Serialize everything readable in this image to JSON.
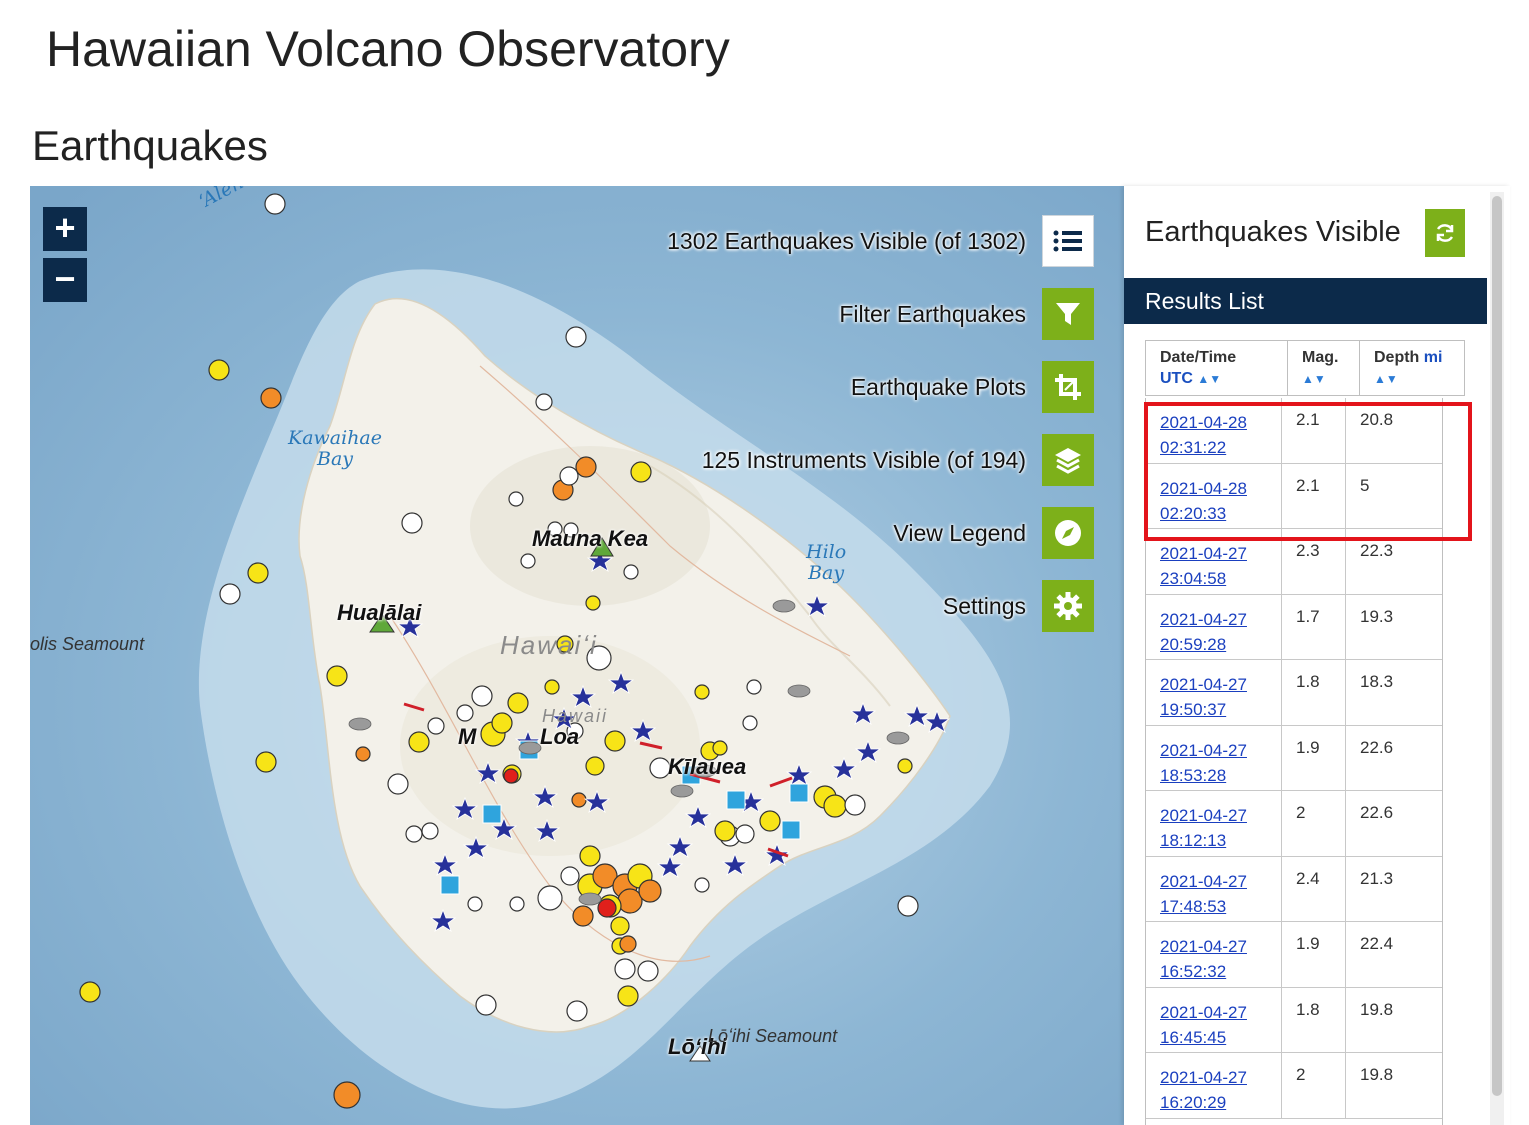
{
  "site_title": "Hawaiian Volcano Observatory",
  "section_title": "Earthquakes",
  "map": {
    "zoom_in": "+",
    "zoom_out": "−",
    "controls": [
      {
        "label": "1302 Earthquakes Visible (of 1302)",
        "icon": "list-icon"
      },
      {
        "label": "Filter Earthquakes",
        "icon": "filter-icon"
      },
      {
        "label": "Earthquake Plots",
        "icon": "crop-icon"
      },
      {
        "label": "125 Instruments Visible (of 194)",
        "icon": "layers-icon"
      },
      {
        "label": "View Legend",
        "icon": "compass-icon"
      },
      {
        "label": "Settings",
        "icon": "gear-icon"
      }
    ],
    "places": {
      "mauna_kea": "Mauna Kea",
      "hualalai": "Hualālai",
      "mauna_loa_a": "M",
      "mauna_loa_b": "Loa",
      "kilauea": "Kīlauea",
      "loihi": "Lōʻihi",
      "hawaii": "Hawaiʻi",
      "hawaii_small": "Hawaii",
      "kawaihae": "Kawaihae",
      "bay1": "Bay",
      "hilo": "Hilo",
      "bay2": "Bay",
      "alenuihaha": "ʻAlen",
      "seamount_west": "olis Seamount",
      "seamount_south": "Lōʻihi Seamount"
    }
  },
  "panel": {
    "title": "Earthquakes Visible",
    "results_label": "Results List",
    "columns": {
      "date": "Date/Time",
      "date_sub": "UTC",
      "mag": "Mag.",
      "depth": "Depth",
      "depth_unit": "mi"
    },
    "rows": [
      {
        "date": "2021-04-28",
        "time": "02:31:22",
        "mag": "2.1",
        "depth": "20.8"
      },
      {
        "date": "2021-04-28",
        "time": "02:20:33",
        "mag": "2.1",
        "depth": "5"
      },
      {
        "date": "2021-04-27",
        "time": "23:04:58",
        "mag": "2.3",
        "depth": "22.3"
      },
      {
        "date": "2021-04-27",
        "time": "20:59:28",
        "mag": "1.7",
        "depth": "19.3"
      },
      {
        "date": "2021-04-27",
        "time": "19:50:37",
        "mag": "1.8",
        "depth": "18.3"
      },
      {
        "date": "2021-04-27",
        "time": "18:53:28",
        "mag": "1.9",
        "depth": "22.6"
      },
      {
        "date": "2021-04-27",
        "time": "18:12:13",
        "mag": "2",
        "depth": "22.6"
      },
      {
        "date": "2021-04-27",
        "time": "17:48:53",
        "mag": "2.4",
        "depth": "21.3"
      },
      {
        "date": "2021-04-27",
        "time": "16:52:32",
        "mag": "1.9",
        "depth": "22.4"
      },
      {
        "date": "2021-04-27",
        "time": "16:45:45",
        "mag": "1.8",
        "depth": "19.8"
      },
      {
        "date": "2021-04-27",
        "time": "16:20:29",
        "mag": "2",
        "depth": "19.8"
      }
    ]
  },
  "colors": {
    "accent_green": "#7db01a",
    "navy": "#0c2a4a",
    "link_blue": "#1a3fbf",
    "highlight_red": "#e3141b",
    "quake_white": "#ffffff",
    "quake_yellow": "#f7e417",
    "quake_orange": "#f28c28",
    "quake_red": "#e0201b",
    "station_star": "#27319a"
  }
}
